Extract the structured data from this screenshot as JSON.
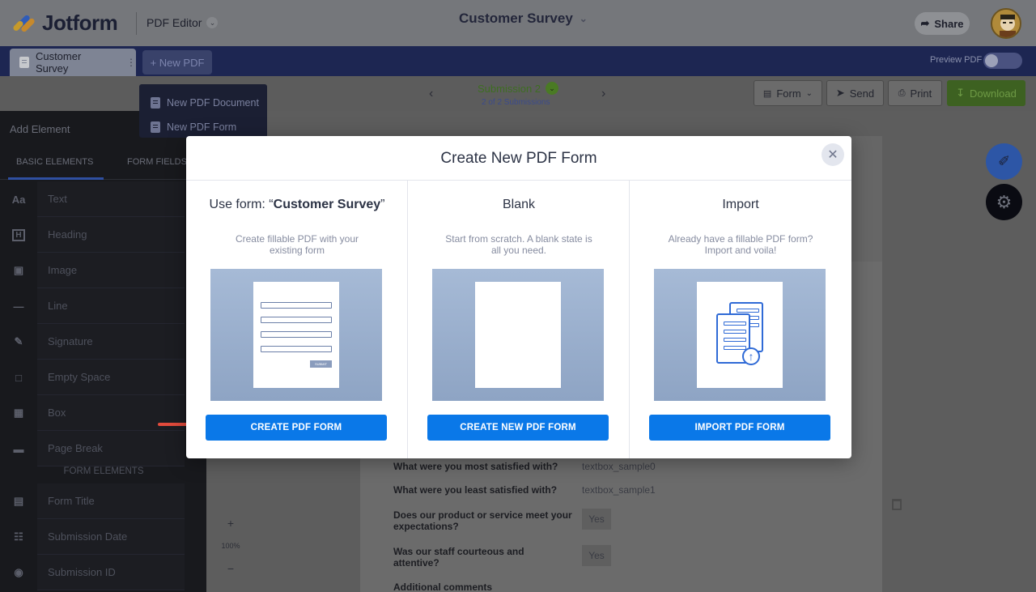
{
  "header": {
    "logo_text": "Jotform",
    "product": "PDF Editor",
    "document_title": "Customer Survey",
    "share_label": "Share"
  },
  "tabs": {
    "active_tab": "Customer Survey",
    "new_pdf": "+ New PDF",
    "preview_label": "Preview PDF"
  },
  "new_pdf_menu": {
    "items": [
      "New PDF Document",
      "New PDF Form"
    ]
  },
  "toolbar": {
    "submission_title": "Submission 2",
    "submission_count": "2 of 2 Submissions",
    "form_label": "Form",
    "send_label": "Send",
    "print_label": "Print",
    "download_label": "Download"
  },
  "left_panel": {
    "title": "Add Element",
    "tabs": [
      "BASIC ELEMENTS",
      "FORM FIELDS"
    ],
    "basic_elements": [
      "Text",
      "Heading",
      "Image",
      "Line",
      "Signature",
      "Empty Space",
      "Box",
      "Page Break"
    ],
    "form_elements_header": "FORM ELEMENTS",
    "form_elements": [
      "Form Title",
      "Submission Date",
      "Submission ID"
    ]
  },
  "canvas": {
    "zoom": "100%",
    "rows": [
      {
        "question": "What were you most satisfied with?",
        "answer": "textbox_sample0"
      },
      {
        "question": "What were you least satisfied with?",
        "answer": "textbox_sample1"
      },
      {
        "question": "Does our product or service meet your expectations?",
        "answer": "Yes"
      },
      {
        "question": "Was our staff courteous and attentive?",
        "answer": "Yes"
      },
      {
        "question": "Additional comments",
        "answer": ""
      }
    ]
  },
  "modal": {
    "title": "Create New PDF Form",
    "use_form": {
      "heading_prefix": "Use form: “",
      "heading_name": "Customer Survey",
      "heading_suffix": "”",
      "description": "Create fillable PDF with your existing form",
      "button": "CREATE PDF FORM",
      "mini_submit": "SUBMIT"
    },
    "blank": {
      "heading": "Blank",
      "description": "Start from scratch. A blank state is all you need.",
      "button": "CREATE NEW PDF FORM"
    },
    "import": {
      "heading": "Import",
      "description": "Already have a fillable PDF form? Import and voila!",
      "button": "IMPORT PDF FORM"
    }
  },
  "colors": {
    "primary_button": "#0a78e8",
    "tab_bar": "#1d2652",
    "download": "#3d6121",
    "annotation_arrow": "#e24b3c"
  }
}
